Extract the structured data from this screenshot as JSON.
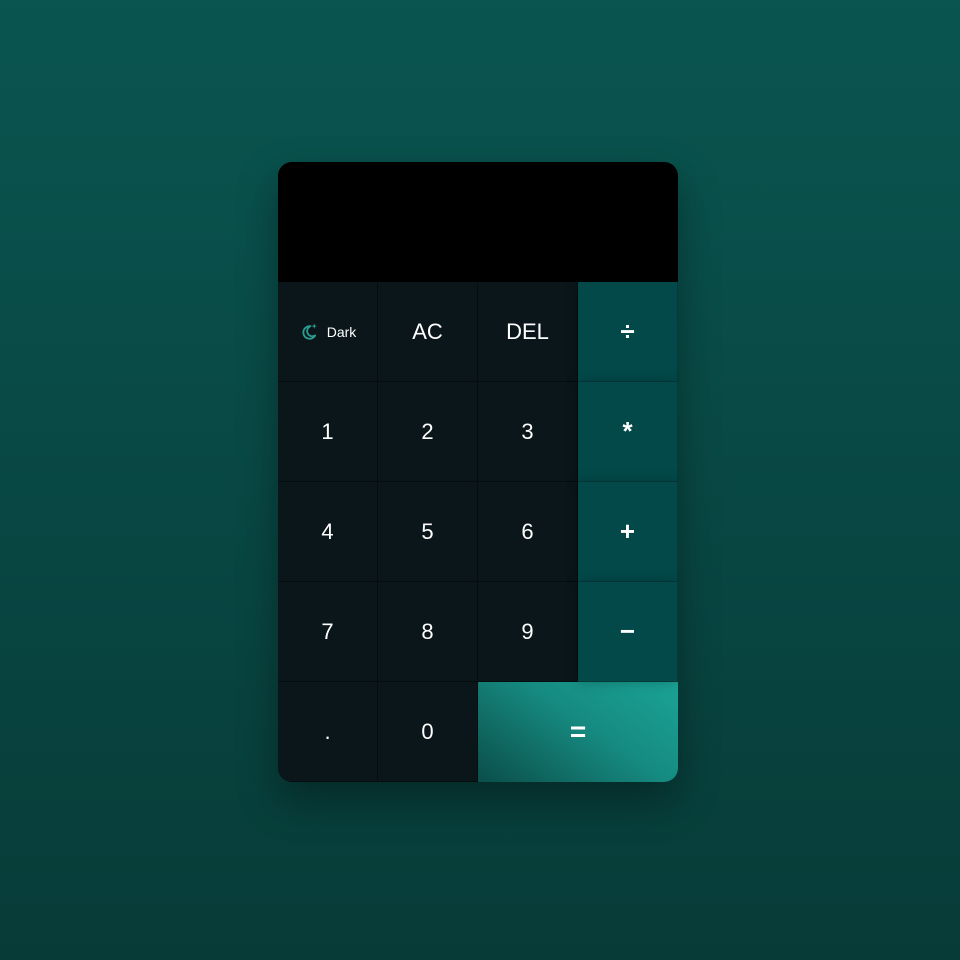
{
  "display": {
    "value": ""
  },
  "keys": {
    "theme_label": "Dark",
    "theme_icon": "moon-stars-icon",
    "clear": "AC",
    "delete": "DEL",
    "divide": "÷",
    "multiply": "*",
    "add": "+",
    "subtract": "−",
    "equals": "=",
    "decimal": ".",
    "digits": {
      "d0": "0",
      "d1": "1",
      "d2": "2",
      "d3": "3",
      "d4": "4",
      "d5": "5",
      "d6": "6",
      "d7": "7",
      "d8": "8",
      "d9": "9"
    }
  },
  "colors": {
    "background": "#0a5550",
    "display": "#000000",
    "number_key": "#0a1619",
    "operator_key": "#03494a",
    "equals_key": "#168a80",
    "accent": "#2a9d8f"
  }
}
